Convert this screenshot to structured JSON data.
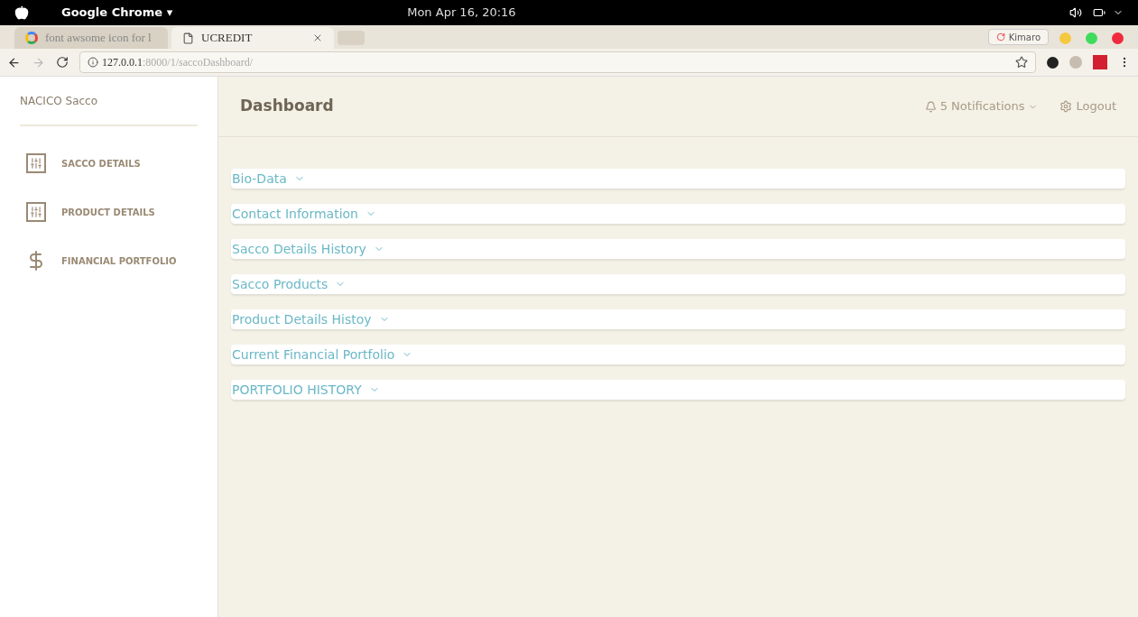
{
  "top_bar": {
    "app_menu": "Google Chrome ▾",
    "clock": "Mon Apr 16, 20:16"
  },
  "tabs": [
    {
      "title": "font awsome icon for l",
      "selected": false,
      "kind": "google"
    },
    {
      "title": "UCREDIT",
      "selected": true,
      "kind": "page"
    }
  ],
  "profile": {
    "name": "Kimaro"
  },
  "address_bar": {
    "host": "127.0.0.1",
    "path": ":8000/1/saccoDashboard/"
  },
  "sidebar": {
    "brand": "NACICO Sacco",
    "items": [
      {
        "label": "SACCO DETAILS",
        "kind": "sliders"
      },
      {
        "label": "PRODUCT DETAILS",
        "kind": "sliders"
      },
      {
        "label": "FINANCIAL PORTFOLIO",
        "kind": "dollar"
      }
    ]
  },
  "header": {
    "title": "Dashboard",
    "notifications": "5 Notifications",
    "logout": "Logout"
  },
  "sections": [
    "Bio-Data",
    "Contact Information",
    "Sacco Details History",
    "Sacco Products",
    "Product Details Histoy",
    "Current Financial Portfolio",
    "PORTFOLIO HISTORY"
  ]
}
